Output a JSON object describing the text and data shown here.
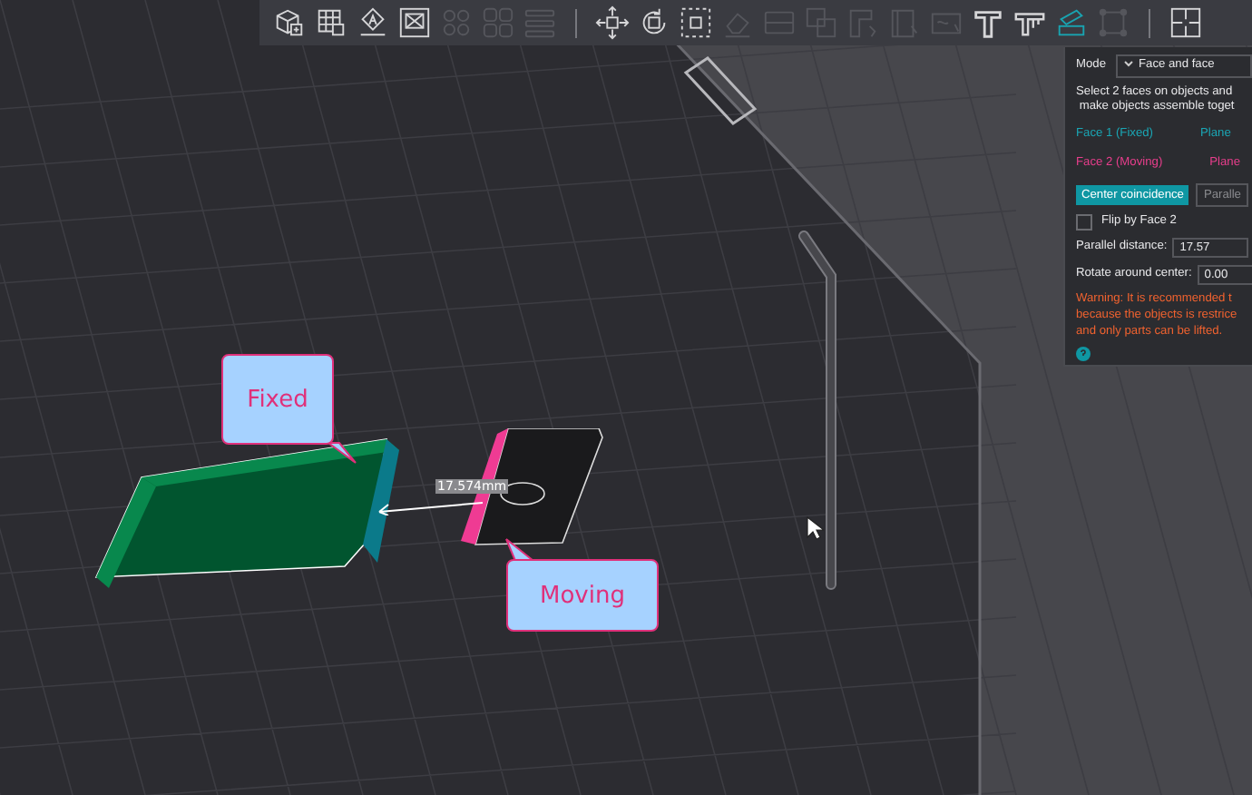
{
  "toolbar": {
    "groups": [
      [
        {
          "disabled": false,
          "selected": false
        },
        {
          "disabled": false,
          "selected": false
        },
        {
          "disabled": false,
          "selected": false
        },
        {
          "disabled": false,
          "selected": false
        },
        {
          "disabled": true,
          "selected": false
        },
        {
          "disabled": true,
          "selected": false
        },
        {
          "disabled": true,
          "selected": false
        }
      ],
      [
        {
          "disabled": false,
          "selected": false
        },
        {
          "disabled": false,
          "selected": false
        },
        {
          "disabled": false,
          "selected": false
        },
        {
          "disabled": true,
          "selected": false
        },
        {
          "disabled": true,
          "selected": false
        },
        {
          "disabled": true,
          "selected": false
        },
        {
          "disabled": true,
          "selected": false
        },
        {
          "disabled": true,
          "selected": false
        },
        {
          "disabled": true,
          "selected": false
        },
        {
          "disabled": false,
          "selected": false
        },
        {
          "disabled": false,
          "selected": false
        },
        {
          "disabled": false,
          "selected": true
        },
        {
          "disabled": true,
          "selected": false
        }
      ],
      [
        {
          "disabled": false,
          "selected": false
        }
      ]
    ]
  },
  "panel": {
    "mode_label": "Mode",
    "mode_value": "Face and face",
    "instructions": "Select 2 faces on objects and\n make objects assemble toget",
    "faces": [
      {
        "label": "Face 1 (Fixed)",
        "value": "Plane",
        "color": "#1aa6b4"
      },
      {
        "label": "Face 2 (Moving)",
        "value": "Plane",
        "color": "#e83e8c"
      }
    ],
    "options": [
      {
        "label": "Center coincidence",
        "selected": true
      },
      {
        "label": "Paralle",
        "selected": false
      }
    ],
    "flip": {
      "label": "Flip by Face 2",
      "checked": false
    },
    "fields": [
      {
        "label": "Parallel distance:",
        "value": "17.57"
      },
      {
        "label": "Rotate around center:",
        "value": "0.00"
      }
    ],
    "warning": "Warning: It is recommended t\nbecause the objects is restrice\nand only parts can be lifted."
  },
  "scene": {
    "callouts": [
      {
        "text": "Fixed"
      },
      {
        "text": "Moving"
      }
    ],
    "distance": "17.574mm"
  }
}
